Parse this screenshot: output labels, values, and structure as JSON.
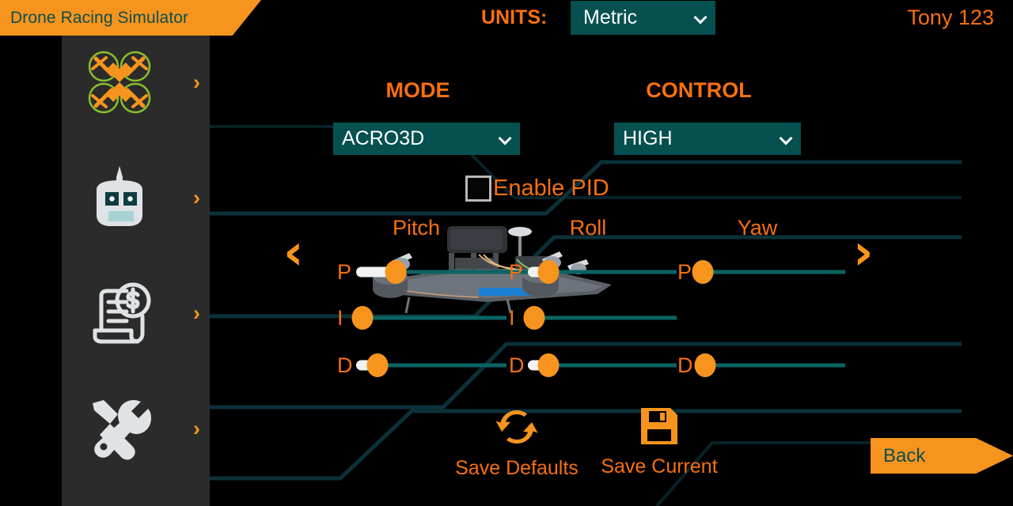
{
  "app": {
    "title": "Drone Racing Simulator",
    "username": "Tony 123"
  },
  "header": {
    "units_label": "UNITS:",
    "units_value": "Metric",
    "units_options": [
      "Metric"
    ]
  },
  "sidebar": {
    "items": [
      {
        "icon": "drone-icon",
        "chevron": "›"
      },
      {
        "icon": "transmitter-icon",
        "chevron": "›"
      },
      {
        "icon": "invoice-dollar-icon",
        "chevron": "›"
      },
      {
        "icon": "tools-icon",
        "chevron": "›"
      }
    ]
  },
  "settings": {
    "mode": {
      "title": "MODE",
      "value": "ACRO3D",
      "options": [
        "ACRO3D"
      ]
    },
    "control": {
      "title": "CONTROL",
      "value": "HIGH",
      "options": [
        "HIGH"
      ]
    },
    "enable_pid": {
      "label": "Enable PID",
      "checked": false
    }
  },
  "pid": {
    "nav_prev": "‹",
    "nav_next": "›",
    "columns": [
      {
        "title": "Pitch",
        "rows": [
          {
            "label": "P",
            "fill_pct": 14,
            "thumb_pct": 14
          },
          {
            "label": "I",
            "fill_pct": 0,
            "thumb_pct": 4
          },
          {
            "label": "D",
            "fill_pct": 14,
            "thumb_pct": 14
          }
        ]
      },
      {
        "title": "Roll",
        "rows": [
          {
            "label": "P",
            "fill_pct": 14,
            "thumb_pct": 14
          },
          {
            "label": "I",
            "fill_pct": 0,
            "thumb_pct": 4
          },
          {
            "label": "D",
            "fill_pct": 14,
            "thumb_pct": 14
          }
        ]
      },
      {
        "title": "Yaw",
        "rows": [
          {
            "label": "P",
            "fill_pct": 0,
            "thumb_pct": 4
          },
          {
            "label": "D",
            "fill_pct": 6,
            "thumb_pct": 6
          }
        ]
      }
    ]
  },
  "actions": {
    "save_defaults": {
      "label": "Save Defaults",
      "icon": "refresh-icon"
    },
    "save_current": {
      "label": "Save Current",
      "icon": "floppy-disk-icon"
    },
    "back": {
      "label": "Back"
    }
  },
  "colors": {
    "orange": "#F7941E",
    "orange_text": "#F7700E",
    "teal": "#065050",
    "track": "#0b6464",
    "sidebar": "#2b2b2b",
    "banner_text": "#0a4f4f"
  }
}
